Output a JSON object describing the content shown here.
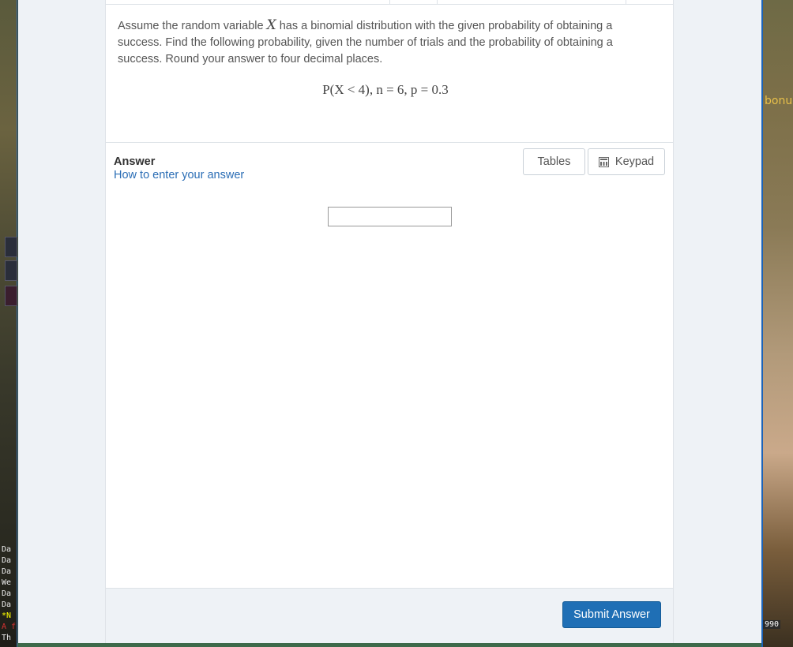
{
  "background": {
    "left_chat_lines": [
      "Da",
      "Da",
      "Da",
      "We",
      "Da",
      "Da",
      "*N",
      "A f",
      "Th"
    ],
    "right_text_top": "bonu",
    "right_text_bottom": "990"
  },
  "question": {
    "text_before_var": "Assume the random variable ",
    "variable": "X",
    "text_after_var": " has a binomial distribution with the given probability of obtaining a success. Find the following probability, given the number of trials and the probability of obtaining a success. Round your answer to four decimal places.",
    "formula": "P(X < 4), n = 6, p = 0.3"
  },
  "answer": {
    "label": "Answer",
    "howto_link": "How to enter your answer",
    "tables_label": "Tables",
    "keypad_label": "Keypad",
    "input_value": "",
    "submit_label": "Submit Answer"
  },
  "colors": {
    "accent": "#1f6fb5",
    "link": "#2a6db5",
    "page_bg": "#eef2f6"
  }
}
